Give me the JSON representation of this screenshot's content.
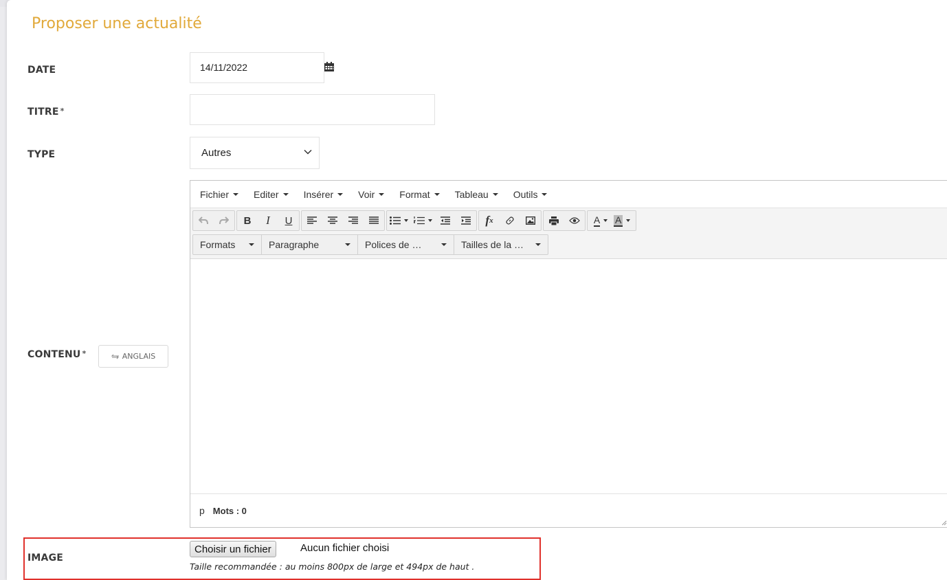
{
  "page": {
    "title": "Proposer une actualité"
  },
  "form": {
    "date": {
      "label": "DATE",
      "value": "14/11/2022"
    },
    "titre": {
      "label": "TITRE",
      "required": "*",
      "value": ""
    },
    "type": {
      "label": "TYPE",
      "selected": "Autres"
    },
    "contenu": {
      "label": "CONTENU",
      "required": "*",
      "lang_button": "ANGLAIS"
    },
    "image": {
      "label": "IMAGE",
      "choose_button": "Choisir un fichier",
      "status": "Aucun fichier choisi",
      "hint": "Taille recommandée : au moins 800px de large et 494px de haut ."
    }
  },
  "editor": {
    "menu": [
      "Fichier",
      "Editer",
      "Insérer",
      "Voir",
      "Format",
      "Tableau",
      "Outils"
    ],
    "toolbar_icons": [
      "undo-icon",
      "redo-icon",
      "bold-icon",
      "italic-icon",
      "underline-icon",
      "align-left-icon",
      "align-center-icon",
      "align-right-icon",
      "align-justify-icon",
      "bullet-list-icon",
      "numbered-list-icon",
      "outdent-icon",
      "indent-icon",
      "formula-icon",
      "link-icon",
      "image-icon",
      "print-icon",
      "preview-icon",
      "text-color-icon",
      "background-color-icon"
    ],
    "dropdowns": [
      "Formats",
      "Paragraphe",
      "Polices de …",
      "Tailles de la …"
    ],
    "status": {
      "element": "p",
      "word_count": "Mots : 0"
    },
    "toolbar_letters": {
      "bold": "B",
      "italic": "I",
      "underline": "U",
      "color": "A"
    }
  },
  "colors": {
    "title": "#e1a93a",
    "highlight_border": "#e0302b"
  }
}
